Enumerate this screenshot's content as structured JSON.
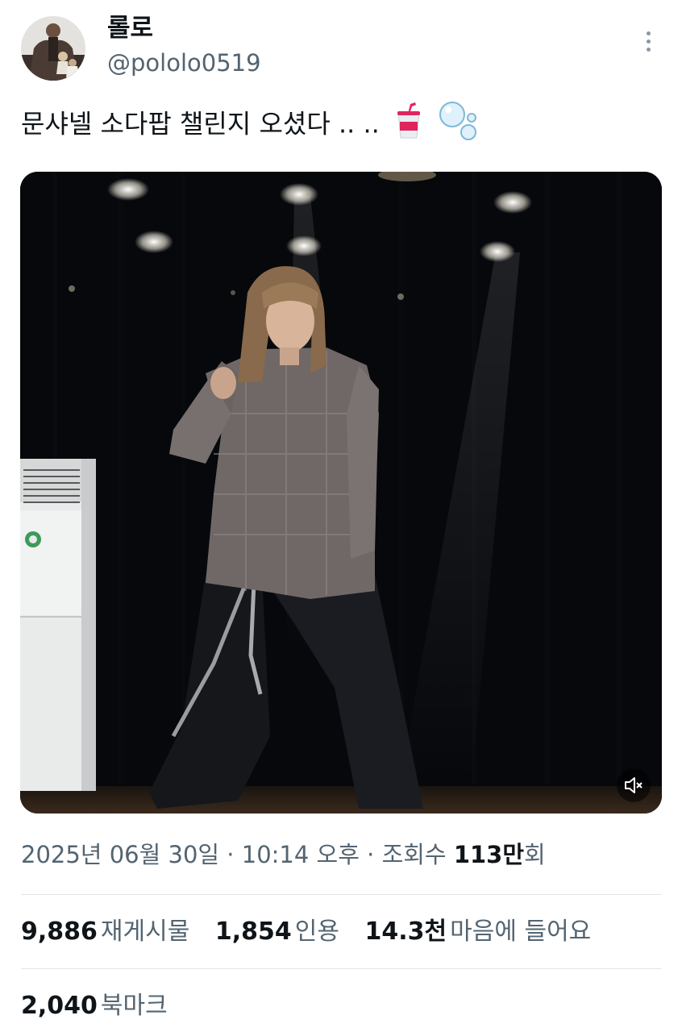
{
  "author": {
    "display_name": "롤로",
    "handle": "@pololo0519"
  },
  "tweet": {
    "text": "문샤넬 소다팝 챌린지 오셨다 .. ..",
    "emojis": [
      "cup-with-straw-emoji",
      "bubbles-emoji"
    ]
  },
  "media": {
    "type": "video",
    "muted": true,
    "control_icon": "speaker-muted-icon"
  },
  "meta": {
    "date": "2025년 06월 30일",
    "separator1": " · ",
    "time": "10:14 오후",
    "separator2": " · ",
    "views_label": "조회수 ",
    "views_count": "113만",
    "views_suffix": "회"
  },
  "stats": {
    "reposts": {
      "count": "9,886",
      "label": "재게시물"
    },
    "quotes": {
      "count": "1,854",
      "label": "인용"
    },
    "likes": {
      "count": "14.3천",
      "label": "마음에 들어요"
    },
    "bookmarks": {
      "count": "2,040",
      "label": "북마크"
    }
  },
  "colors": {
    "text_primary": "#0f1419",
    "text_secondary": "#536471",
    "divider": "#e1e6ea"
  }
}
